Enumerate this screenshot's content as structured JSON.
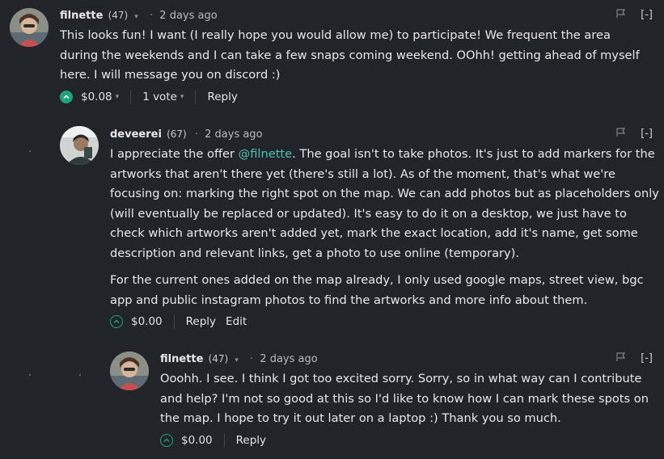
{
  "comments": [
    {
      "author": "filnette",
      "reputation": "(47)",
      "time": "2 days ago",
      "paragraphs": [
        "This looks fun! I want (I really hope you would allow me) to participate! We frequent the area during the weekends and I can take a few snaps coming weekend. OOhh! getting ahead of myself here. I will message you on discord :)"
      ],
      "payout": "$0.08",
      "votes": "1 vote",
      "actions": [
        "Reply"
      ],
      "collapse": "[-]"
    },
    {
      "author": "deveerei",
      "reputation": "(67)",
      "time": "2 days ago",
      "p1_before": "I appreciate the offer ",
      "p1_mention": "@filnette",
      "p1_after": ". The goal isn't to take photos. It's just to add markers for the artworks that aren't there yet (there's still a lot). As of the moment, that's what we're focusing on: marking the right spot on the map. We can add photos but as placeholders only (will eventually be replaced or updated). It's easy to do it on a desktop, we just have to check which artworks aren't added yet, mark the exact location, add it's name, get some description and relevant links, get a photo to use online (temporary).",
      "p2": "For the current ones added on the map already, I only used google maps, street view, bgc app and public instagram photos to find the artworks and more info about them.",
      "payout": "$0.00",
      "actions": [
        "Reply",
        "Edit"
      ],
      "collapse": "[-]"
    },
    {
      "author": "filnette",
      "reputation": "(47)",
      "time": "2 days ago",
      "paragraphs": [
        "Ooohh. I see. I think I got too excited sorry. Sorry, so in what way can I contribute and help? I'm not so good at this so I'd like to know how I can mark these spots on the map. I hope to try it out later on a laptop :) Thank you so much."
      ],
      "payout": "$0.00",
      "actions": [
        "Reply"
      ],
      "collapse": "[-]"
    }
  ],
  "icons": {
    "caret": "▾",
    "upvote": "chevron-up-icon",
    "flag": "flag-icon"
  },
  "colors": {
    "background": "#212429",
    "accent": "#1fa37a",
    "mention": "#4fc2b0"
  }
}
